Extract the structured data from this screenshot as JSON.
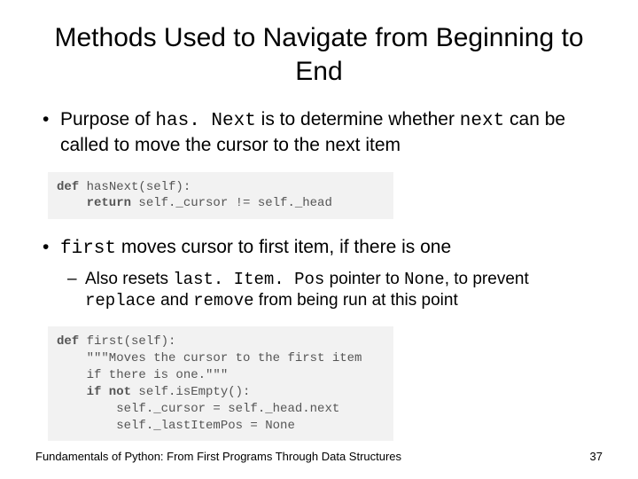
{
  "title": "Methods Used to Navigate from Beginning to End",
  "bullet1": {
    "pre": "Purpose of ",
    "code1": "has. Next",
    "mid": " is to determine whether ",
    "code2": "next",
    "post": " can be called to move the cursor to the next item"
  },
  "code1": {
    "l1a": "def",
    "l1b": " hasNext(self):",
    "l2a": "    return",
    "l2b": " self._cursor != self._head"
  },
  "bullet2": {
    "code": "first",
    "post": " moves cursor to first item, if there is one"
  },
  "bullet2sub": {
    "pre": "Also resets ",
    "code1": "last. Item. Pos",
    "mid1": " pointer to ",
    "code2": "None",
    "mid2": ", to prevent ",
    "code3": "replace",
    "mid3": " and ",
    "code4": "remove",
    "post": " from being run at this point"
  },
  "code2": {
    "l1a": "def",
    "l1b": " first(self):",
    "l2": "    \"\"\"Moves the cursor to the first item",
    "l3": "    if there is one.\"\"\"",
    "l4a": "    if not",
    "l4b": " self.isEmpty():",
    "l5": "        self._cursor = self._head.next",
    "l6": "        self._lastItemPos = None"
  },
  "footer": {
    "left": "Fundamentals of Python: From First Programs Through Data Structures",
    "right": "37"
  }
}
